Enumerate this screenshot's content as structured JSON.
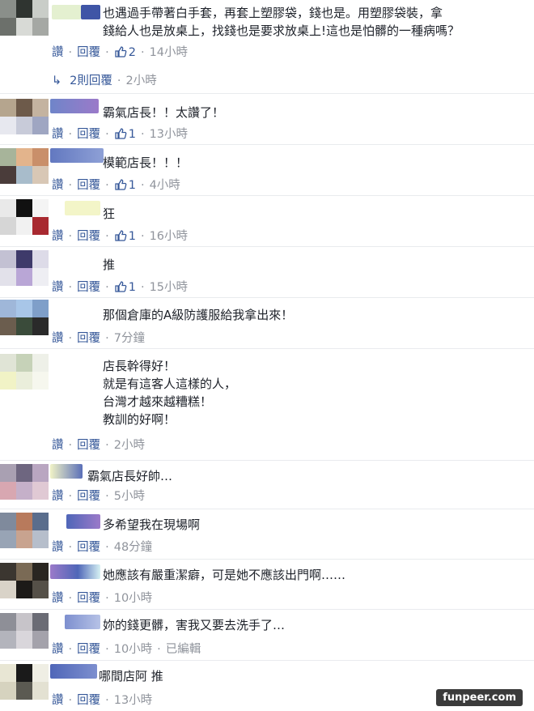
{
  "labels": {
    "like": "讚",
    "reply": "回覆",
    "separator": "·"
  },
  "first_reply_toggle": {
    "text": "2則回覆",
    "time": "2小時"
  },
  "comments": [
    {
      "text": "也遇過手帶著白手套，再套上塑膠袋，錢也是。用塑膠袋裝，拿\n錢給人也是放桌上，找錢也是要求放桌上!這也是怕髒的一種病嗎？",
      "likes": "2",
      "time": "14小時"
    },
    {
      "text": "霸氣店長！！太讚了！",
      "likes": "1",
      "time": "13小時"
    },
    {
      "text": "模範店長！！！",
      "likes": "1",
      "time": "4小時"
    },
    {
      "text": "狂",
      "likes": "1",
      "time": "16小時"
    },
    {
      "text": "推",
      "likes": "1",
      "time": "15小時"
    },
    {
      "text": "那個倉庫的A級防護服給我拿出來！",
      "likes": "",
      "time": "7分鐘"
    },
    {
      "text": "店長幹得好！\n就是有這客人這樣的人，\n台灣才越來越糟糕！\n教訓的好啊！",
      "likes": "",
      "time": "2小時"
    },
    {
      "text": "霸氣店長好帥…",
      "likes": "",
      "time": "5小時"
    },
    {
      "text": "多希望我在現場啊",
      "likes": "",
      "time": "48分鐘"
    },
    {
      "text": "她應該有嚴重潔癖，可是她不應該出門啊……",
      "likes": "",
      "time": "10小時"
    },
    {
      "text": "妳的錢更髒，害我又要去洗手了…",
      "likes": "",
      "time": "10小時",
      "edited": "已編輯"
    },
    {
      "text": "哪間店阿 推",
      "likes": "",
      "time": "13小時"
    }
  ],
  "watermark": "funpeer.com",
  "colors": {
    "link": "#365899",
    "meta": "#90949c",
    "text": "#1d2129"
  }
}
